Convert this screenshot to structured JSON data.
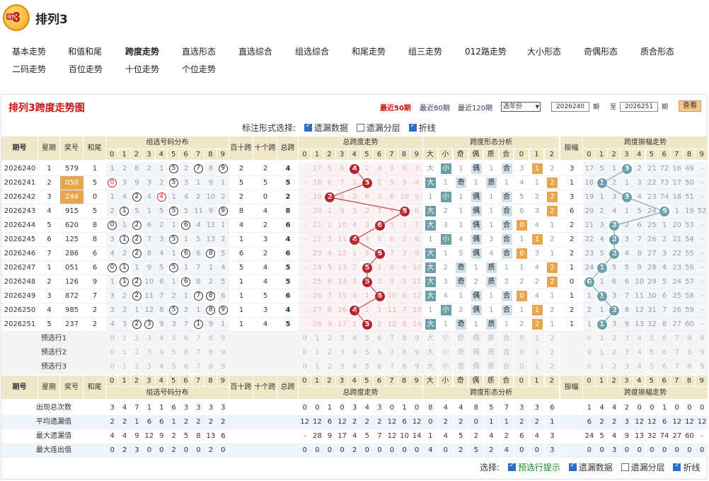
{
  "header": {
    "logo_text": "排列",
    "logo_num": "3",
    "title": "排列3"
  },
  "nav": [
    "基本走势",
    "和值和尾",
    "跨度走势",
    "直选形态",
    "直选综合",
    "组选综合",
    "和尾走势",
    "组三走势",
    "012路走势",
    "大小形态",
    "奇偶形态",
    "质合形态",
    "二码走势",
    "百位走势",
    "十位走势",
    "个位走势"
  ],
  "nav_active": 2,
  "panel": {
    "title": "排列3跨度走势图",
    "links": [
      "最近50期",
      "最近80期",
      "最近120期"
    ],
    "select_value": "选年份",
    "from": "2026240",
    "to": "2026251",
    "qi": "期",
    "zhi": "至",
    "query": "查看"
  },
  "options": {
    "label": "标注形式选择:",
    "items": [
      {
        "label": "遗漏数据",
        "checked": true
      },
      {
        "label": "遗漏分层",
        "checked": false
      },
      {
        "label": "折线",
        "checked": true
      }
    ]
  },
  "headers": {
    "issue": "期号",
    "week": "星期",
    "prize": "奖号",
    "hewei": "和尾",
    "group": "组选号码分布",
    "bs": "百十跨",
    "sg": "十个跨",
    "zk": "总跨",
    "ztrend": "总跨度走势",
    "shape": "跨度形态分析",
    "amp": "振幅",
    "amptrend": "跨度振幅走势"
  },
  "digits": [
    "0",
    "1",
    "2",
    "3",
    "4",
    "5",
    "6",
    "7",
    "8",
    "9"
  ],
  "shape_cols": [
    "大",
    "小",
    "奇",
    "偶",
    "质",
    "合",
    "0",
    "1",
    "2"
  ],
  "amp_digits": [
    "0",
    "1",
    "2",
    "3",
    "4",
    "5",
    "6",
    "7",
    "8",
    "9"
  ],
  "rows": [
    {
      "issue": "2026240",
      "week": "1",
      "prize": "579",
      "hewei": "1",
      "prize_hl": false,
      "group": [
        "1",
        "2",
        "8",
        "2",
        "1",
        "5",
        "2",
        "7",
        "8",
        "9"
      ],
      "group_hit": [
        5,
        7,
        9
      ],
      "group_red": [],
      "bs": "2",
      "sg": "2",
      "zk": "4",
      "tr": [
        "-",
        "17",
        "5",
        "6",
        "4",
        "2",
        "4",
        "1",
        "8",
        "3"
      ],
      "span": 4,
      "sh": [
        "大",
        "小",
        "1",
        "偶",
        "1",
        "合",
        "3",
        "1",
        "2"
      ],
      "sh_on": [
        1,
        3,
        5,
        7
      ],
      "sh_dark": [],
      "amp": "3",
      "at": [
        "17",
        "5",
        "1",
        "3",
        "2",
        "21",
        "72",
        "16",
        "49",
        "-"
      ],
      "ahit": 3
    },
    {
      "issue": "2026241",
      "week": "2",
      "prize": "050",
      "hewei": "5",
      "prize_hl": true,
      "group": [
        "0",
        "3",
        "9",
        "3",
        "2",
        "5",
        "3",
        "1",
        "9",
        "1"
      ],
      "group_hit": [
        0,
        5
      ],
      "group_red": [
        0
      ],
      "bs": "5",
      "sg": "5",
      "zk": "5",
      "tr": [
        "-",
        "18",
        "6",
        "7",
        "1",
        "5",
        "2",
        "5",
        "9",
        "4"
      ],
      "span": 5,
      "sh": [
        "大",
        "1",
        "奇",
        "1",
        "质",
        "1",
        "4",
        "1",
        "2"
      ],
      "sh_on": [
        0,
        2,
        4,
        8
      ],
      "sh_dark": [
        0
      ],
      "amp": "1",
      "at": [
        "18",
        "1",
        "2",
        "1",
        "3",
        "22",
        "73",
        "17",
        "50",
        "-"
      ],
      "ahit": 1
    },
    {
      "issue": "2026242",
      "week": "3",
      "prize": "244",
      "hewei": "0",
      "prize_hl": true,
      "group": [
        "1",
        "4",
        "2",
        "4",
        "4",
        "1",
        "4",
        "2",
        "10",
        "2"
      ],
      "group_hit": [
        2,
        4
      ],
      "group_red": [
        4
      ],
      "bs": "2",
      "sg": "0",
      "zk": "2",
      "tr": [
        "-",
        "19",
        "2",
        "8",
        "2",
        "6",
        "3",
        "6",
        "10",
        "5"
      ],
      "span": 2,
      "sh": [
        "1",
        "小",
        "1",
        "偶",
        "1",
        "合",
        "5",
        "2",
        "2"
      ],
      "sh_on": [
        1,
        3,
        5,
        8
      ],
      "sh_dark": [],
      "amp": "3",
      "at": [
        "19",
        "1",
        "3",
        "3",
        "4",
        "23",
        "74",
        "18",
        "51",
        "-"
      ],
      "ahit": 3
    },
    {
      "issue": "2026243",
      "week": "4",
      "prize": "915",
      "hewei": "5",
      "prize_hl": false,
      "group": [
        "2",
        "1",
        "5",
        "1",
        "5",
        "5",
        "5",
        "11",
        "9",
        "9"
      ],
      "group_hit": [
        1,
        5,
        9
      ],
      "group_red": [],
      "bs": "8",
      "sg": "4",
      "zk": "8",
      "tr": [
        "-",
        "20",
        "1",
        "9",
        "3",
        "2",
        "7",
        "4",
        "8",
        "6"
      ],
      "span": 8,
      "sh": [
        "大",
        "2",
        "1",
        "偶",
        "1",
        "合",
        "6",
        "3",
        "2"
      ],
      "sh_on": [
        0,
        3,
        5,
        8
      ],
      "sh_dark": [
        0
      ],
      "amp": "6",
      "at": [
        "20",
        "2",
        "4",
        "1",
        "5",
        "24",
        "6",
        "1",
        "19",
        "52"
      ],
      "ahit": 6
    },
    {
      "issue": "2026244",
      "week": "5",
      "prize": "620",
      "hewei": "8",
      "prize_hl": false,
      "group": [
        "0",
        "1",
        "2",
        "6",
        "2",
        "1",
        "6",
        "4",
        "12",
        "1"
      ],
      "group_hit": [
        0,
        2,
        6
      ],
      "group_red": [],
      "bs": "4",
      "sg": "2",
      "zk": "6",
      "tr": [
        "-",
        "21",
        "2",
        "10",
        "4",
        "3",
        "6",
        "5",
        "1",
        "7"
      ],
      "span": 6,
      "sh": [
        "大",
        "3",
        "1",
        "偶",
        "1",
        "合",
        "0",
        "4",
        "1"
      ],
      "sh_on": [
        0,
        3,
        5,
        6
      ],
      "sh_dark": [
        0
      ],
      "amp": "2",
      "at": [
        "21",
        "3",
        "2",
        "2",
        "6",
        "25",
        "1",
        "20",
        "53",
        "-"
      ],
      "ahit": 2
    },
    {
      "issue": "2026245",
      "week": "6",
      "prize": "125",
      "hewei": "8",
      "prize_hl": false,
      "group": [
        "3",
        "1",
        "2",
        "7",
        "3",
        "5",
        "1",
        "5",
        "13",
        "2"
      ],
      "group_hit": [
        1,
        2,
        5
      ],
      "group_red": [],
      "bs": "1",
      "sg": "3",
      "zk": "4",
      "tr": [
        "-",
        "22",
        "3",
        "11",
        "4",
        "4",
        "1",
        "6",
        "2",
        "8"
      ],
      "span": 4,
      "sh": [
        "1",
        "小",
        "4",
        "偶",
        "3",
        "合",
        "1",
        "1",
        "2"
      ],
      "sh_on": [
        1,
        3,
        5,
        7
      ],
      "sh_dark": [],
      "amp": "2",
      "at": [
        "22",
        "4",
        "2",
        "3",
        "7",
        "26",
        "2",
        "21",
        "54",
        "-"
      ],
      "ahit": 2
    },
    {
      "issue": "2026246",
      "week": "7",
      "prize": "286",
      "hewei": "6",
      "prize_hl": false,
      "group": [
        "4",
        "2",
        "2",
        "8",
        "4",
        "1",
        "6",
        "6",
        "8",
        "5"
      ],
      "group_hit": [
        2,
        6,
        8
      ],
      "group_red": [],
      "bs": "6",
      "sg": "2",
      "zk": "6",
      "tr": [
        "-",
        "23",
        "4",
        "12",
        "1",
        "5",
        "6",
        "7",
        "3",
        "9"
      ],
      "span": 6,
      "sh": [
        "大",
        "1",
        "5",
        "偶",
        "4",
        "合",
        "0",
        "3",
        "1"
      ],
      "sh_on": [
        0,
        3,
        5,
        6
      ],
      "sh_dark": [
        0
      ],
      "amp": "2",
      "at": [
        "23",
        "5",
        "2",
        "4",
        "8",
        "27",
        "3",
        "22",
        "55",
        "-"
      ],
      "ahit": 2
    },
    {
      "issue": "2026247",
      "week": "1",
      "prize": "051",
      "hewei": "6",
      "prize_hl": false,
      "group": [
        "0",
        "1",
        "1",
        "9",
        "5",
        "5",
        "1",
        "7",
        "1",
        "4"
      ],
      "group_hit": [
        0,
        1,
        5
      ],
      "group_red": [],
      "bs": "5",
      "sg": "4",
      "zk": "5",
      "tr": [
        "-",
        "24",
        "5",
        "13",
        "2",
        "5",
        "1",
        "8",
        "4",
        "10"
      ],
      "span": 5,
      "sh": [
        "大",
        "2",
        "奇",
        "1",
        "质",
        "1",
        "1",
        "4",
        "2"
      ],
      "sh_on": [
        0,
        2,
        4,
        8
      ],
      "sh_dark": [
        0
      ],
      "amp": "1",
      "at": [
        "24",
        "1",
        "5",
        "5",
        "9",
        "28",
        "4",
        "23",
        "56",
        "-"
      ],
      "ahit": 1
    },
    {
      "issue": "2026248",
      "week": "2",
      "prize": "126",
      "hewei": "9",
      "prize_hl": false,
      "group": [
        "1",
        "1",
        "2",
        "10",
        "6",
        "1",
        "6",
        "8",
        "2",
        "5"
      ],
      "group_hit": [
        1,
        2,
        6
      ],
      "group_red": [],
      "bs": "1",
      "sg": "4",
      "zk": "5",
      "tr": [
        "-",
        "25",
        "6",
        "14",
        "3",
        "5",
        "2",
        "9",
        "5",
        "11"
      ],
      "span": 5,
      "sh": [
        "大",
        "3",
        "奇",
        "2",
        "质",
        "2",
        "2",
        "2",
        "2"
      ],
      "sh_on": [
        0,
        2,
        4,
        8
      ],
      "sh_dark": [
        0
      ],
      "amp": "0",
      "at": [
        "0",
        "1",
        "6",
        "6",
        "10",
        "29",
        "5",
        "24",
        "57",
        "-"
      ],
      "ahit": 0
    },
    {
      "issue": "2026249",
      "week": "3",
      "prize": "872",
      "hewei": "7",
      "prize_hl": false,
      "group": [
        "3",
        "2",
        "2",
        "11",
        "7",
        "2",
        "1",
        "7",
        "8",
        "6"
      ],
      "group_hit": [
        2,
        7,
        8
      ],
      "group_red": [],
      "bs": "1",
      "sg": "5",
      "zk": "6",
      "tr": [
        "-",
        "26",
        "7",
        "15",
        "4",
        "1",
        "6",
        "10",
        "6",
        "12"
      ],
      "span": 6,
      "sh": [
        "大",
        "4",
        "1",
        "偶",
        "1",
        "合",
        "0",
        "4",
        "1"
      ],
      "sh_on": [
        0,
        3,
        5,
        6
      ],
      "sh_dark": [
        0
      ],
      "amp": "1",
      "at": [
        "1",
        "1",
        "3",
        "7",
        "11",
        "30",
        "6",
        "25",
        "58",
        "-"
      ],
      "ahit": 1
    },
    {
      "issue": "2026250",
      "week": "4",
      "prize": "985",
      "hewei": "2",
      "prize_hl": false,
      "group": [
        "3",
        "2",
        "1",
        "12",
        "8",
        "5",
        "2",
        "1",
        "8",
        "9"
      ],
      "group_hit": [
        5,
        8,
        9
      ],
      "group_red": [],
      "bs": "1",
      "sg": "3",
      "zk": "4",
      "tr": [
        "-",
        "27",
        "8",
        "16",
        "4",
        "2",
        "1",
        "11",
        "7",
        "13"
      ],
      "span": 4,
      "sh": [
        "1",
        "小",
        "2",
        "偶",
        "1",
        "合",
        "1",
        "1",
        "2"
      ],
      "sh_on": [
        1,
        3,
        5,
        7
      ],
      "sh_dark": [],
      "amp": "2",
      "at": [
        "2",
        "1",
        "2",
        "8",
        "12",
        "31",
        "7",
        "26",
        "59",
        "-"
      ],
      "ahit": 2
    },
    {
      "issue": "2026251",
      "week": "5",
      "prize": "237",
      "hewei": "2",
      "prize_hl": false,
      "group": [
        "4",
        "3",
        "2",
        "3",
        "9",
        "3",
        "7",
        "1",
        "9",
        "1"
      ],
      "group_hit": [
        2,
        3,
        7
      ],
      "group_red": [],
      "bs": "1",
      "sg": "4",
      "zk": "5",
      "tr": [
        "-",
        "28",
        "9",
        "17",
        "1",
        "5",
        "2",
        "12",
        "8",
        "14"
      ],
      "span": 5,
      "sh": [
        "大",
        "1",
        "奇",
        "1",
        "质",
        "1",
        "2",
        "2",
        "1"
      ],
      "sh_on": [
        0,
        2,
        4,
        7
      ],
      "sh_dark": [
        0
      ],
      "amp": "1",
      "at": [
        "1",
        "1",
        "3",
        "9",
        "13",
        "32",
        "8",
        "27",
        "60",
        "-"
      ],
      "ahit": 1
    }
  ],
  "predict_rows": [
    "预选行1",
    "预选行2",
    "预选行3"
  ],
  "stats": [
    {
      "label": "出现总次数",
      "group": [
        "3",
        "4",
        "7",
        "1",
        "1",
        "6",
        "3",
        "3",
        "3",
        "3"
      ],
      "tr": [
        "0",
        "0",
        "1",
        "0",
        "3",
        "4",
        "3",
        "0",
        "1",
        "0"
      ],
      "sh": [
        "8",
        "4",
        "4",
        "8",
        "5",
        "7",
        "3",
        "3",
        "6"
      ],
      "at": [
        "1",
        "4",
        "4",
        "2",
        "0",
        "0",
        "1",
        "0",
        "0",
        "0"
      ]
    },
    {
      "label": "平均遗漏值",
      "group": [
        "2",
        "2",
        "1",
        "6",
        "6",
        "1",
        "2",
        "2",
        "2",
        "2"
      ],
      "tr": [
        "12",
        "12",
        "6",
        "12",
        "2",
        "2",
        "2",
        "12",
        "6",
        "12"
      ],
      "sh": [
        "0",
        "2",
        "2",
        "0",
        "1",
        "1",
        "2",
        "2",
        "1"
      ],
      "at": [
        "6",
        "2",
        "2",
        "3",
        "12",
        "12",
        "6",
        "12",
        "12",
        "12"
      ]
    },
    {
      "label": "最大遗漏值",
      "group": [
        "4",
        "4",
        "9",
        "12",
        "9",
        "2",
        "5",
        "8",
        "13",
        "6"
      ],
      "tr": [
        "-",
        "28",
        "9",
        "17",
        "4",
        "5",
        "7",
        "12",
        "10",
        "14"
      ],
      "sh": [
        "1",
        "4",
        "5",
        "2",
        "4",
        "2",
        "6",
        "4",
        "3"
      ],
      "at": [
        "24",
        "5",
        "4",
        "9",
        "13",
        "32",
        "74",
        "27",
        "60",
        "-"
      ]
    },
    {
      "label": "最大连出值",
      "group": [
        "0",
        "2",
        "3",
        "0",
        "0",
        "2",
        "0",
        "0",
        "2",
        "0"
      ],
      "tr": [
        "0",
        "0",
        "0",
        "0",
        "2",
        "0",
        "0",
        "0",
        "0",
        "0"
      ],
      "sh": [
        "4",
        "0",
        "2",
        "5",
        "2",
        "4",
        "0",
        "0",
        "3"
      ],
      "at": [
        "0",
        "0",
        "3",
        "0",
        "0",
        "0",
        "0",
        "0",
        "0",
        "0"
      ]
    }
  ],
  "bottom": {
    "label": "选择:",
    "items": [
      {
        "label": "预选行提示",
        "checked": true
      },
      {
        "label": "遗漏数据",
        "checked": true
      },
      {
        "label": "遗漏分层",
        "checked": false
      },
      {
        "label": "折线",
        "checked": true
      }
    ]
  },
  "colors": {
    "accent": "#c11",
    "span_ball": "#b5232e",
    "amp_ball": "#6b9fa8",
    "header": "#f0e6c8"
  }
}
